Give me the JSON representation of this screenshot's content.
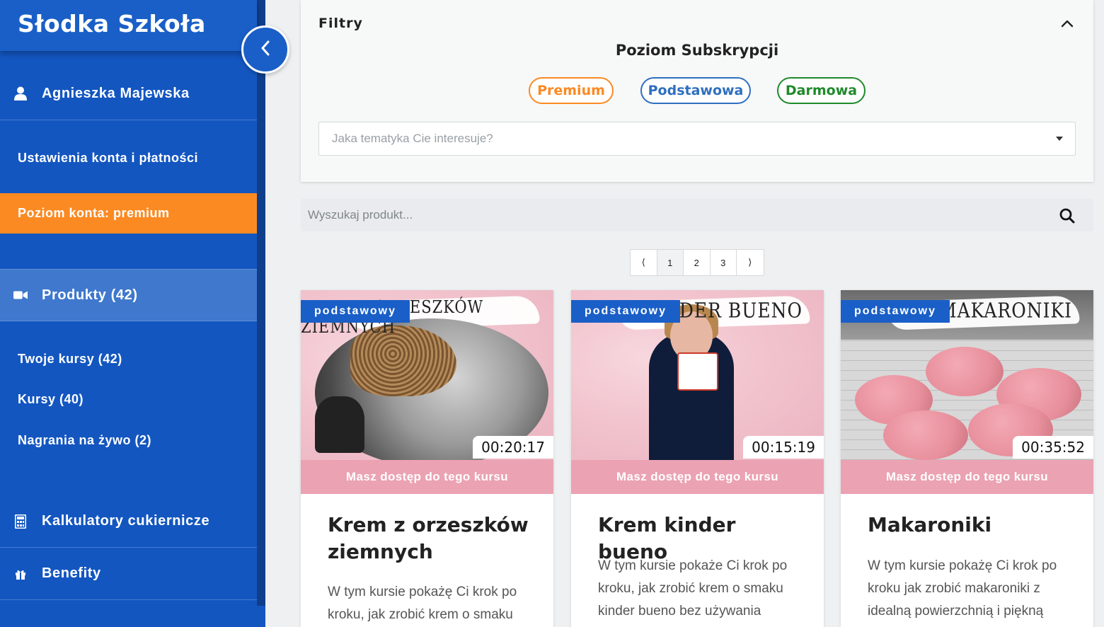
{
  "sidebar": {
    "brand": "Słodka Szkoła",
    "user_name": "Agnieszka Majewska",
    "account_settings": "Ustawienia konta i płatności",
    "account_level": "Poziom konta: premium",
    "products": "Produkty (42)",
    "sub_items": [
      "Twoje kursy (42)",
      "Kursy (40)",
      "Nagrania na żywo (2)"
    ],
    "calculators": "Kalkulatory cukiernicze",
    "benefits": "Benefity"
  },
  "filters": {
    "title": "Filtry",
    "subscription_title": "Poziom Subskrypcji",
    "levels": [
      "Premium",
      "Podstawowa",
      "Darmowa"
    ],
    "topic_placeholder": "Jaka tematyka Cie interesuje?"
  },
  "search": {
    "placeholder": "Wyszukaj produkt..."
  },
  "pagination": {
    "prev": "⟨",
    "pages": [
      "1",
      "2",
      "3"
    ],
    "next": "⟩",
    "current": "1"
  },
  "cards": [
    {
      "badge": "podstawowy",
      "image_text": "KREM Z ORZESZKÓW ZIEMNYCH",
      "duration": "00:20:17",
      "access": "Masz dostęp do tego kursu",
      "title": "Krem z orzeszków ziemnych",
      "desc": "W tym kursie pokażę Ci krok po kroku, jak zrobić krem o smaku"
    },
    {
      "badge": "podstawowy",
      "image_text": "KREM KINDER BUENO",
      "duration": "00:15:19",
      "access": "Masz dostęp do tego kursu",
      "title": "Krem kinder bueno",
      "desc": "W tym kursie pokaże Ci krok po kroku, jak zrobić krem o smaku kinder bueno bez używania"
    },
    {
      "badge": "podstawowy",
      "image_text": "MAKARONIKI",
      "duration": "00:35:52",
      "access": "Masz dostęp do tego kursu",
      "title": "Makaroniki",
      "desc": "W tym kursie pokażę Ci krok po kroku jak zrobić makaroniki z idealną powierzchnią i piękną"
    }
  ],
  "colors": {
    "sidebar": "#1356c0",
    "accent_orange": "#fb8a23",
    "accent_blue": "#2f6fbf",
    "accent_green": "#1f8a2a",
    "access_pink": "#eba2b2"
  },
  "icons": {
    "collapse": "chevron-left-icon",
    "user": "user-icon",
    "products": "video-camera-icon",
    "calculators": "calculator-icon",
    "benefits": "gift-icon",
    "filters_toggle": "chevron-up-icon",
    "search": "search-icon",
    "topic_caret": "caret-down-icon"
  }
}
